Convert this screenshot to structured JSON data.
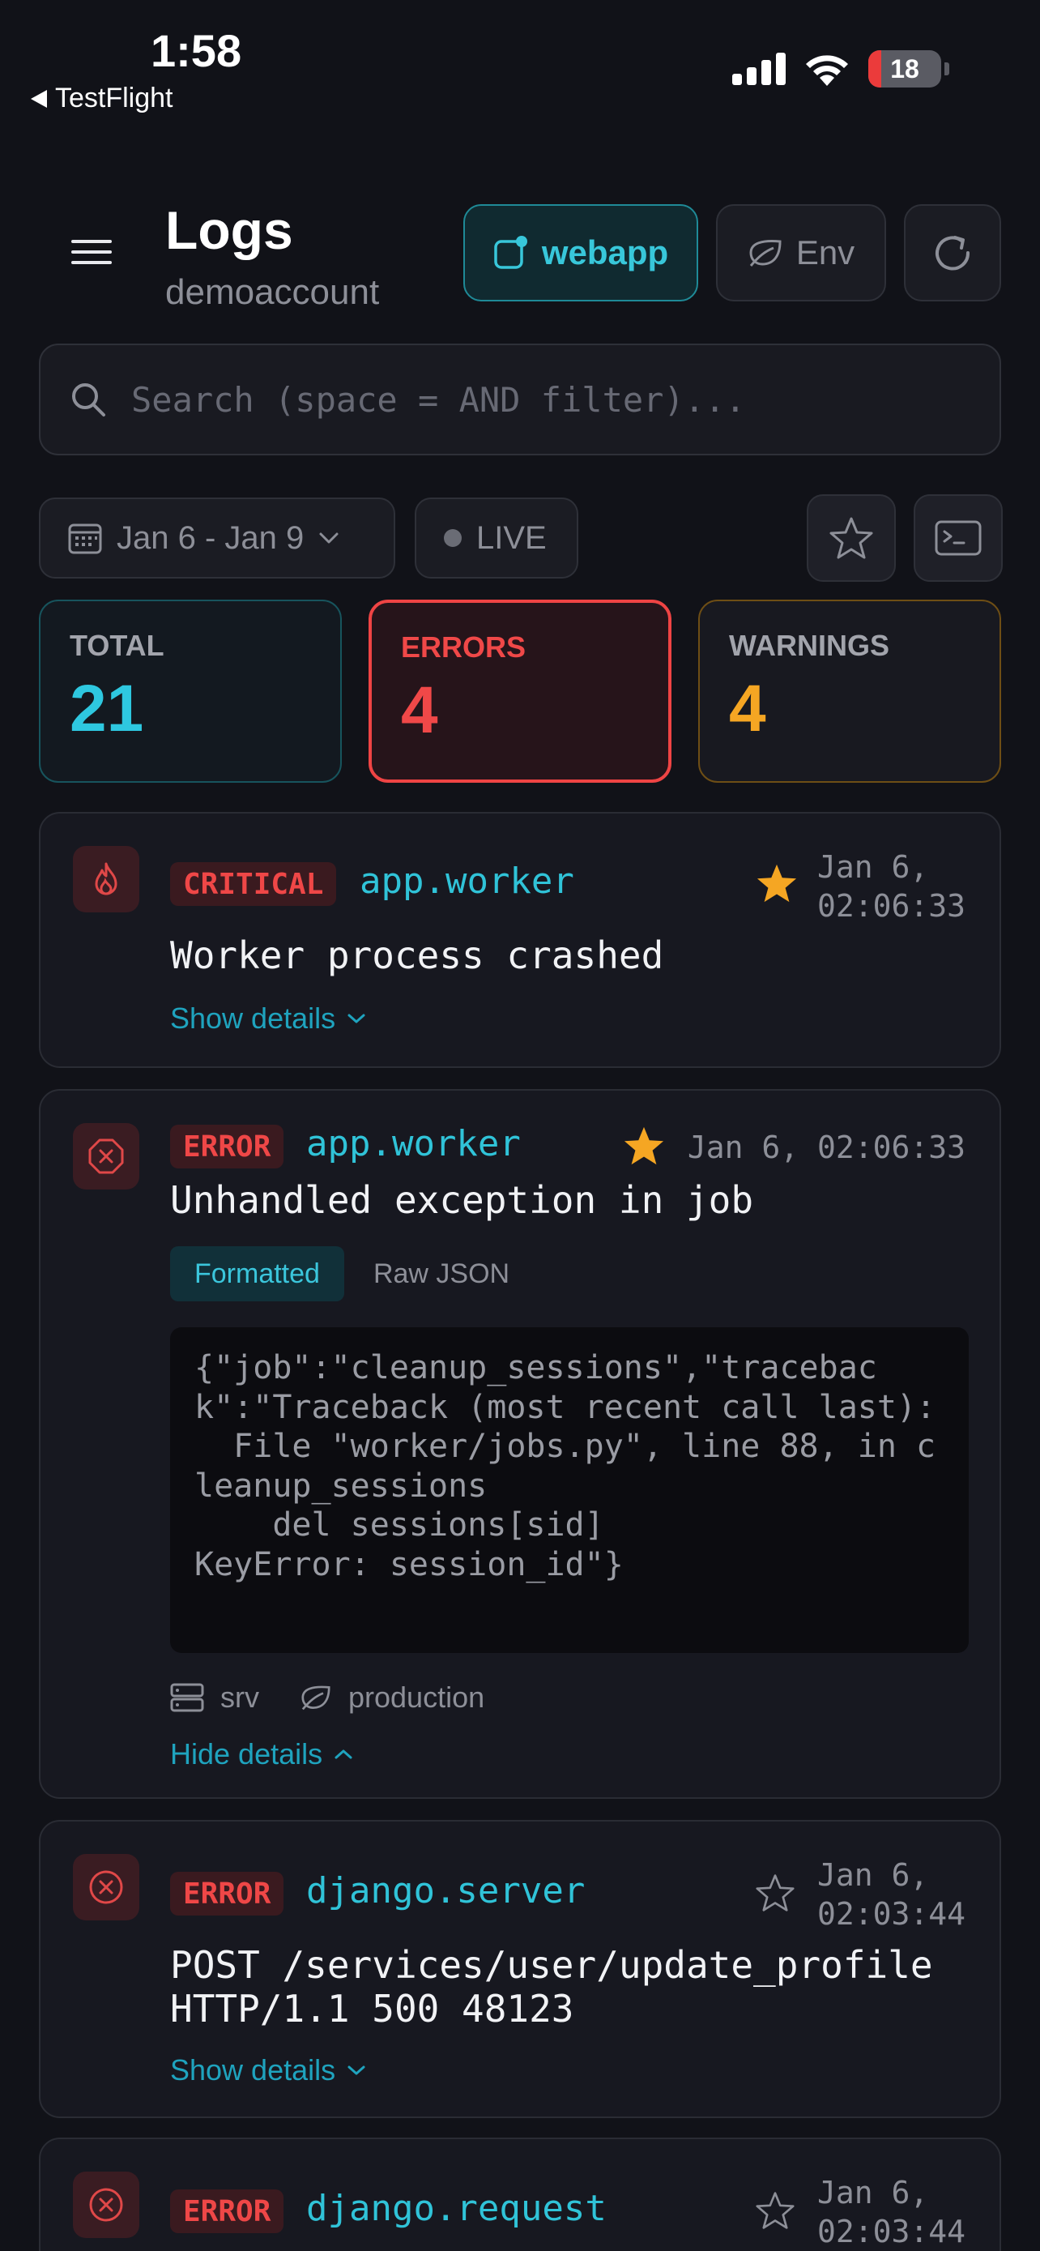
{
  "status_bar": {
    "time": "1:58",
    "back_label": "TestFlight",
    "battery": "18"
  },
  "header": {
    "title": "Logs",
    "subtitle": "demoaccount",
    "app_button": "webapp",
    "env_button": "Env"
  },
  "search": {
    "placeholder": "Search (space = AND filter)..."
  },
  "filters": {
    "date_range": "Jan 6 - Jan 9",
    "live_label": "LIVE"
  },
  "stats": {
    "total_label": "TOTAL",
    "total_value": "21",
    "errors_label": "ERRORS",
    "errors_value": "4",
    "warnings_label": "WARNINGS",
    "warnings_value": "4"
  },
  "logs": [
    {
      "level": "CRITICAL",
      "source": "app.worker",
      "starred": true,
      "ts_line1": "Jan 6,",
      "ts_line2": "02:06:33",
      "message": "Worker process crashed",
      "toggle": "Show details"
    },
    {
      "level": "ERROR",
      "source": "app.worker",
      "starred": true,
      "ts": "Jan 6, 02:06:33",
      "message": "Unhandled exception in job",
      "tab_formatted": "Formatted",
      "tab_raw": "Raw JSON",
      "code": "{\"job\":\"cleanup_sessions\",\"traceback\":\"Traceback (most recent call last):\n  File \"worker/jobs.py\", line 88, in cleanup_sessions\n    del sessions[sid]\nKeyError: session_id\"}",
      "meta_host": "srv",
      "meta_env": "production",
      "toggle": "Hide details"
    },
    {
      "level": "ERROR",
      "source": "django.server",
      "starred": false,
      "ts_line1": "Jan 6,",
      "ts_line2": "02:03:44",
      "message_line1": "POST /services/user/update_profile",
      "message_line2": "HTTP/1.1 500 48123",
      "toggle": "Show details"
    },
    {
      "level": "ERROR",
      "source": "django.request",
      "starred": false,
      "ts_line1": "Jan 6,",
      "ts_line2": "02:03:44"
    }
  ],
  "colors": {
    "accent_cyan": "#30c3d8",
    "error_red": "#ef4444",
    "warning_amber": "#f5a623",
    "star_gold": "#f5a623",
    "background": "#111218"
  }
}
